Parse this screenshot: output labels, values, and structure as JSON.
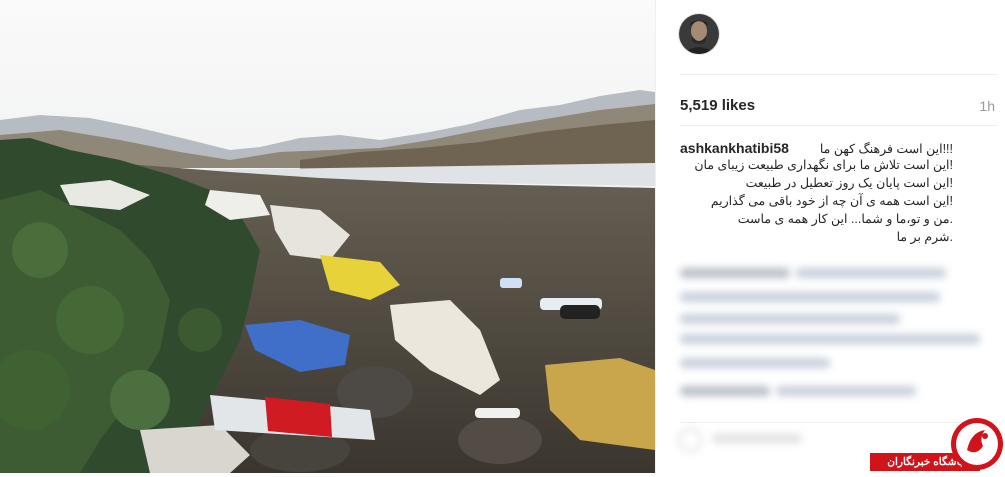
{
  "post": {
    "likes": "5,519 likes",
    "time_ago": "1h",
    "username": "ashkankhatibi58",
    "caption_lines": [
      "!!!این است فرهنگ کهن ما",
      "!این است تلاش ما برای نگهداری طبیعت زیبای مان",
      "!این است پایان یک روز تعطیل در طبیعت",
      "!این است همه ی آن چه از خود باقی می گذاریم",
      ".من و تو،ما و شما... این کار همه ی ماست",
      ".شرم بر ما"
    ]
  },
  "watermark": {
    "label": "باشگاه خبرنگاران"
  },
  "colors": {
    "text": "#262626",
    "muted": "#999999",
    "divider": "#efefef",
    "watermark_red": "#d1131a"
  },
  "icons": {
    "avatar": "user-avatar-icon",
    "watermark_logo": "club-logo-icon"
  }
}
